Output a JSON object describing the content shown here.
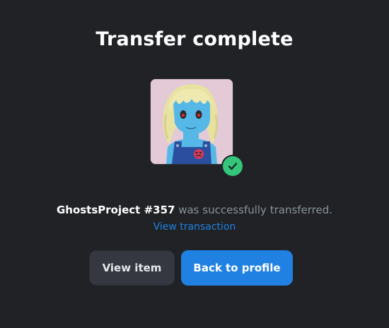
{
  "modal": {
    "title": "Transfer complete",
    "message": {
      "item_name": "GhostsProject #357",
      "suffix": " was successfully transferred."
    },
    "view_transaction_label": "View transaction",
    "buttons": {
      "view_item": "View item",
      "back_to_profile": "Back to profile"
    },
    "icons": {
      "nft_image": "ghost-nft-image",
      "status": "check-circle-icon"
    },
    "colors": {
      "background": "#202225",
      "accent": "#2081e2",
      "success": "#34c77b",
      "secondary_button": "#353840",
      "muted_text": "#8a939b"
    }
  }
}
